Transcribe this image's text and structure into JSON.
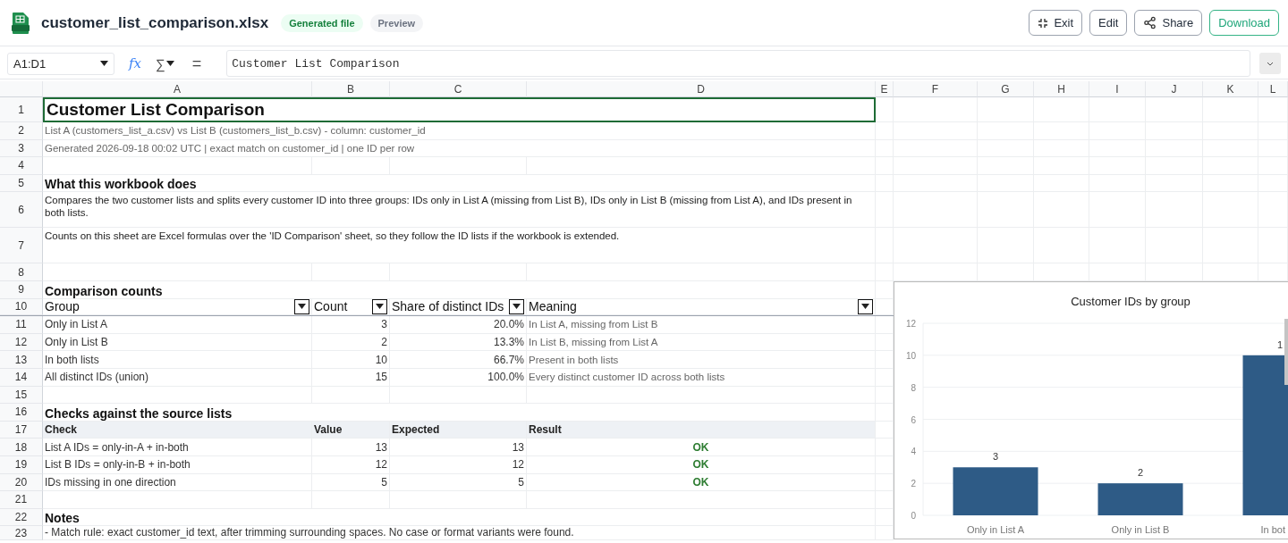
{
  "file": {
    "name": "customer_list_comparison.xlsx",
    "badges": [
      {
        "label": "Generated file",
        "kind": "generated"
      },
      {
        "label": "Preview",
        "kind": "preview"
      }
    ]
  },
  "actions": [
    {
      "label": "Exit",
      "kind": "exit"
    },
    {
      "label": "Edit",
      "kind": "plain"
    },
    {
      "label": "Share",
      "kind": "share"
    },
    {
      "label": "Download",
      "kind": "primary"
    }
  ],
  "formula_bar": {
    "cell_ref": "A1:D1",
    "function_symbol": "fx",
    "sum_symbol": "∑",
    "equals_symbol": "=",
    "value": "Customer List Comparison"
  },
  "columns": [
    "A",
    "B",
    "C",
    "D",
    "E",
    "F",
    "G",
    "H",
    "I",
    "J",
    "K",
    "L"
  ],
  "rows": [
    {
      "number": "1",
      "cells": {
        "A": {
          "kind": "title",
          "text": "Customer List Comparison",
          "selected": true
        }
      }
    },
    {
      "number": "2",
      "cells": {
        "A": {
          "kind": "meta",
          "text": "List A (customers_list_a.csv) vs List B (customers_list_b.csv) - column: customer_id"
        }
      }
    },
    {
      "number": "3",
      "cells": {
        "A": {
          "kind": "meta",
          "text": "Generated 2026-09-18 00:02 UTC  |  exact match on customer_id  |  one ID per row"
        }
      }
    },
    {
      "number": "4",
      "cells": {}
    },
    {
      "number": "5",
      "cells": {
        "A": {
          "kind": "section",
          "text": "What this workbook does"
        }
      }
    },
    {
      "number": "6",
      "cells": {
        "A": {
          "kind": "paragraph",
          "text": "Compares the two customer lists and splits every customer ID into three groups: IDs only in List A (missing from List B), IDs only in List B (missing from List A), and IDs present in both lists."
        }
      }
    },
    {
      "number": "7",
      "cells": {
        "A": {
          "kind": "paragraph",
          "text": "Counts on this sheet are Excel formulas over the 'ID Comparison' sheet, so they follow the ID lists if the workbook is extended."
        }
      }
    },
    {
      "number": "8",
      "cells": {}
    },
    {
      "number": "9",
      "cells": {
        "A": {
          "kind": "section",
          "text": "Comparison counts"
        }
      }
    },
    {
      "number": "10",
      "cells": {
        "A": {
          "kind": "header",
          "text": "Group",
          "filter": true
        },
        "B": {
          "kind": "header",
          "text": "Count",
          "filter": true
        },
        "C": {
          "kind": "header",
          "text": "Share of distinct IDs",
          "filter": true
        },
        "D": {
          "kind": "header",
          "text": "Meaning",
          "filter": true
        }
      }
    },
    {
      "number": "11",
      "cells": {
        "A": {
          "kind": "text",
          "text": "Only in List A"
        },
        "B": {
          "kind": "number",
          "text": "3"
        },
        "C": {
          "kind": "number",
          "text": "20.0%"
        },
        "D": {
          "kind": "meta",
          "text": "In List A, missing from List B"
        }
      }
    },
    {
      "number": "12",
      "cells": {
        "A": {
          "kind": "text",
          "text": "Only in List B"
        },
        "B": {
          "kind": "number",
          "text": "2"
        },
        "C": {
          "kind": "number",
          "text": "13.3%"
        },
        "D": {
          "kind": "meta",
          "text": "In List B, missing from List A"
        }
      }
    },
    {
      "number": "13",
      "cells": {
        "A": {
          "kind": "text",
          "text": "In both lists"
        },
        "B": {
          "kind": "number",
          "text": "10"
        },
        "C": {
          "kind": "number",
          "text": "66.7%"
        },
        "D": {
          "kind": "meta",
          "text": "Present in both lists"
        }
      }
    },
    {
      "number": "14",
      "cells": {
        "A": {
          "kind": "text",
          "text": "All distinct IDs (union)"
        },
        "B": {
          "kind": "number",
          "text": "15"
        },
        "C": {
          "kind": "number",
          "text": "100.0%"
        },
        "D": {
          "kind": "meta",
          "text": "Every distinct customer ID across both lists"
        }
      }
    },
    {
      "number": "15",
      "cells": {}
    },
    {
      "number": "16",
      "cells": {
        "A": {
          "kind": "section",
          "text": "Checks against the source lists"
        }
      }
    },
    {
      "number": "17",
      "cells": {
        "A": {
          "kind": "check_header",
          "text": "Check"
        },
        "B": {
          "kind": "check_header",
          "text": "Value"
        },
        "C": {
          "kind": "check_header",
          "text": "Expected"
        },
        "D": {
          "kind": "check_header",
          "text": "Result"
        }
      }
    },
    {
      "number": "18",
      "cells": {
        "A": {
          "kind": "text",
          "text": "List A IDs = only-in-A + in-both"
        },
        "B": {
          "kind": "number",
          "text": "13"
        },
        "C": {
          "kind": "number",
          "text": "13"
        },
        "D": {
          "kind": "ok",
          "text": "OK"
        }
      }
    },
    {
      "number": "19",
      "cells": {
        "A": {
          "kind": "text",
          "text": "List B IDs = only-in-B + in-both"
        },
        "B": {
          "kind": "number",
          "text": "12"
        },
        "C": {
          "kind": "number",
          "text": "12"
        },
        "D": {
          "kind": "ok",
          "text": "OK"
        }
      }
    },
    {
      "number": "20",
      "cells": {
        "A": {
          "kind": "text",
          "text": "IDs missing in one direction"
        },
        "B": {
          "kind": "number",
          "text": "5"
        },
        "C": {
          "kind": "number",
          "text": "5"
        },
        "D": {
          "kind": "ok",
          "text": "OK"
        }
      }
    },
    {
      "number": "21",
      "cells": {}
    },
    {
      "number": "22",
      "cells": {
        "A": {
          "kind": "section",
          "text": "Notes"
        }
      }
    },
    {
      "number": "23",
      "cells": {
        "A": {
          "kind": "note",
          "text": "- Match rule: exact customer_id text, after trimming surrounding spaces. No case or format variants were found."
        }
      }
    }
  ],
  "chart": {
    "chart_data": {
      "type": "bar",
      "title": "Customer IDs by group",
      "categories": [
        "Only in List A",
        "Only in List B",
        "In bot"
      ],
      "series": [
        {
          "color": "#2e5b86",
          "values": [
            3,
            2,
            10
          ]
        }
      ],
      "ylim": [
        0,
        12
      ],
      "yticks": [
        {
          "value": 0,
          "label": "0"
        },
        {
          "value": 2,
          "label": "2"
        },
        {
          "value": 4,
          "label": "4"
        },
        {
          "value": 6,
          "label": "6"
        },
        {
          "value": 8,
          "label": "8"
        },
        {
          "value": 10,
          "label": "10"
        },
        {
          "value": 12,
          "label": "12"
        }
      ],
      "grid": true,
      "value_labels": [
        "3",
        "2",
        "1"
      ]
    }
  }
}
